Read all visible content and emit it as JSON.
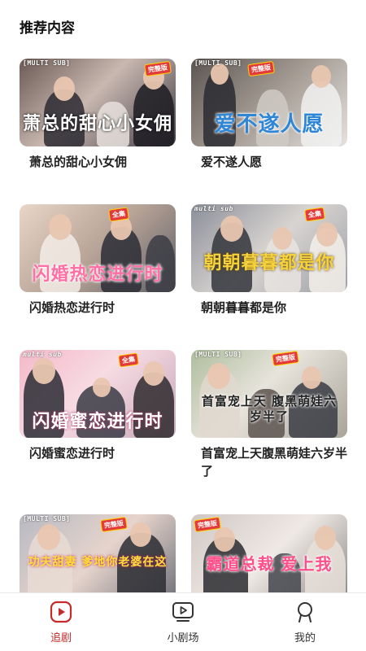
{
  "section": {
    "title": "推荐内容"
  },
  "cards": [
    {
      "title": "萧总的甜心小女佣",
      "overlay": "萧总的甜心小女佣",
      "sub_badge": "[MULTI SUB]",
      "full_badge": "完整版"
    },
    {
      "title": "爱不遂人愿",
      "overlay": "爱不遂人愿",
      "sub_badge": "[MULTI SUB]",
      "full_badge": "完整版"
    },
    {
      "title": "闪婚热恋进行时",
      "overlay": "闪婚热恋进行时",
      "sub_badge": "",
      "full_badge": "全集"
    },
    {
      "title": "朝朝暮暮都是你",
      "overlay": "朝朝暮暮都是你",
      "sub_badge": "multi sub",
      "full_badge": "全集"
    },
    {
      "title": "闪婚蜜恋进行时",
      "overlay": "闪婚蜜恋进行时",
      "sub_badge": "multi sub",
      "full_badge": "全集"
    },
    {
      "title": "首富宠上天腹黑萌娃六岁半了",
      "overlay": "首富宠上天 腹黑萌娃六岁半了",
      "sub_badge": "[MULTI SUB]",
      "full_badge": "完整版"
    },
    {
      "title": "",
      "overlay": "功夫甜妻 爹地你老婆在这",
      "sub_badge": "[MULTI SUB]",
      "full_badge": "完整版"
    },
    {
      "title": "",
      "overlay": "霸道总裁 爱上我",
      "sub_badge": "",
      "full_badge": "完整版"
    }
  ],
  "tabbar": {
    "tabs": [
      {
        "label": "追剧",
        "icon": "play-circle-icon",
        "active": true
      },
      {
        "label": "小剧场",
        "icon": "tv-play-icon",
        "active": false
      },
      {
        "label": "我的",
        "icon": "user-icon",
        "active": false
      }
    ]
  },
  "colors": {
    "accent": "#c62b2b",
    "text": "#222222",
    "divider": "#e8e8e8"
  }
}
